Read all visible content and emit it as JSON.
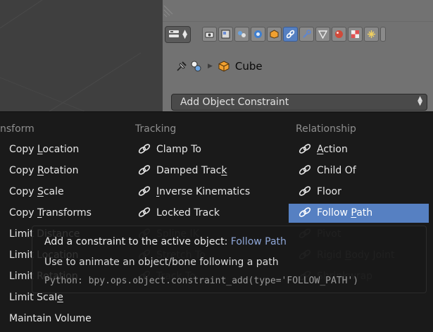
{
  "properties_editor": {
    "breadcrumb": {
      "object_name": "Cube"
    },
    "add_constraint": {
      "label": "Add Object Constraint"
    },
    "context_tabs": [
      {
        "name": "render-tab",
        "icon": "camera-icon",
        "active": false
      },
      {
        "name": "render-layers-tab",
        "icon": "render-layers-icon",
        "active": false
      },
      {
        "name": "scene-tab",
        "icon": "scene-icon",
        "active": false
      },
      {
        "name": "world-tab",
        "icon": "world-icon",
        "active": false
      },
      {
        "name": "object-tab",
        "icon": "object-icon",
        "active": false
      },
      {
        "name": "constraints-tab",
        "icon": "constraint-link-icon",
        "active": true
      },
      {
        "name": "modifiers-tab",
        "icon": "wrench-icon",
        "active": false
      },
      {
        "name": "data-tab",
        "icon": "mesh-data-icon",
        "active": false
      },
      {
        "name": "material-tab",
        "icon": "material-icon",
        "active": false
      },
      {
        "name": "texture-tab",
        "icon": "texture-icon",
        "active": false
      },
      {
        "name": "particles-tab",
        "icon": "particles-icon",
        "active": false
      },
      {
        "name": "physics-tab",
        "icon": "physics-icon",
        "active": false
      }
    ]
  },
  "menu": {
    "columns": [
      {
        "header": "nsform",
        "items": [
          {
            "before": "Copy ",
            "u": "L",
            "after": "ocation",
            "dim": false
          },
          {
            "before": "Copy ",
            "u": "R",
            "after": "otation",
            "dim": false
          },
          {
            "before": "Copy ",
            "u": "S",
            "after": "cale",
            "dim": false
          },
          {
            "before": "Copy ",
            "u": "T",
            "after": "ransforms",
            "dim": false
          },
          {
            "before": "Limi",
            "u": "",
            "after": "t Distance",
            "dim": false
          },
          {
            "before": "Limi",
            "u": "",
            "after": "t Location",
            "dim": false
          },
          {
            "before": "Limi",
            "u": "",
            "after": "t Rotation",
            "dim": false
          },
          {
            "before": "Limit Scal",
            "u": "e",
            "after": "",
            "dim": false
          },
          {
            "before": "Maintain Volume",
            "u": "",
            "after": "",
            "dim": false
          }
        ]
      },
      {
        "header": "Tracking",
        "items": [
          {
            "before": "Clamp To",
            "u": "",
            "after": "",
            "dim": false
          },
          {
            "before": "Damped Trac",
            "u": "k",
            "after": "",
            "dim": false
          },
          {
            "before": "",
            "u": "I",
            "after": "nverse Kinematics",
            "dim": false
          },
          {
            "before": "Locked Track",
            "u": "",
            "after": "",
            "dim": false
          },
          {
            "before": "Spline IK",
            "u": "",
            "after": "",
            "dim": true
          },
          {
            "before": "Stretch To",
            "u": "",
            "after": "",
            "dim": true
          },
          {
            "before": "Track To",
            "u": "",
            "after": "",
            "dim": true
          }
        ]
      },
      {
        "header": "Relationship",
        "items": [
          {
            "before": "",
            "u": "A",
            "after": "ction",
            "dim": false
          },
          {
            "before": "Child Of",
            "u": "",
            "after": "",
            "dim": false
          },
          {
            "before": "Floor",
            "u": "",
            "after": "",
            "dim": false
          },
          {
            "before": "Follow ",
            "u": "P",
            "after": "ath",
            "dim": false,
            "highlight": true
          },
          {
            "before": "Pivot",
            "u": "",
            "after": "",
            "dim": true
          },
          {
            "before": "Rigid ",
            "u": "B",
            "after": "ody Joint",
            "dim": true
          },
          {
            "before": "Shrinkwrap",
            "u": "",
            "after": "",
            "dim": true
          }
        ]
      }
    ]
  },
  "tooltip": {
    "title_prefix": "Add a constraint to the active object:",
    "title_value": "Follow Path",
    "description": "Use to animate an object/bone following a path",
    "python": "Python: bpy.ops.object.constraint_add(type='FOLLOW_PATH')"
  },
  "colors": {
    "menu_bg": "#1a1a1a",
    "highlight": "#5680c2",
    "text": "#e6e6e6",
    "header_text": "#8e8e8e",
    "tooltip_accent": "#8fa7d8"
  }
}
